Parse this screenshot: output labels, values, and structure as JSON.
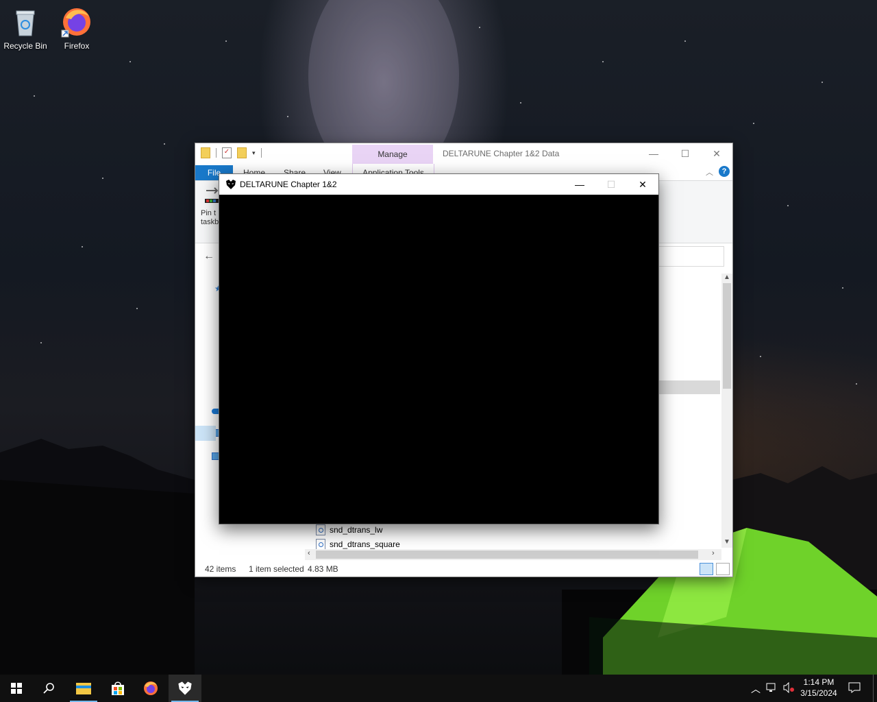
{
  "desktop": {
    "icons": [
      {
        "label": "Recycle Bin"
      },
      {
        "label": "Firefox"
      }
    ]
  },
  "explorer": {
    "title": "DELTARUNE Chapter 1&2 Data",
    "contextual_tab": "Manage",
    "contextual_group": "Application Tools",
    "ribbon_tabs": [
      "File",
      "Home",
      "Share",
      "View"
    ],
    "ribbon_partial": {
      "line1": "Pin t",
      "line2": "taskb"
    },
    "files_visible": [
      "snd_dtrans_lw",
      "snd_dtrans_square"
    ],
    "status": {
      "count": "42 items",
      "selected": "1 item selected",
      "size": "4.83 MB"
    }
  },
  "game_window": {
    "title": "DELTARUNE Chapter 1&2"
  },
  "taskbar": {
    "time": "1:14 PM",
    "date": "3/15/2024"
  },
  "colors": {
    "accent": "#1979ca",
    "manage_tab": "#e9d4f5",
    "tent_green": "#7be02c"
  }
}
